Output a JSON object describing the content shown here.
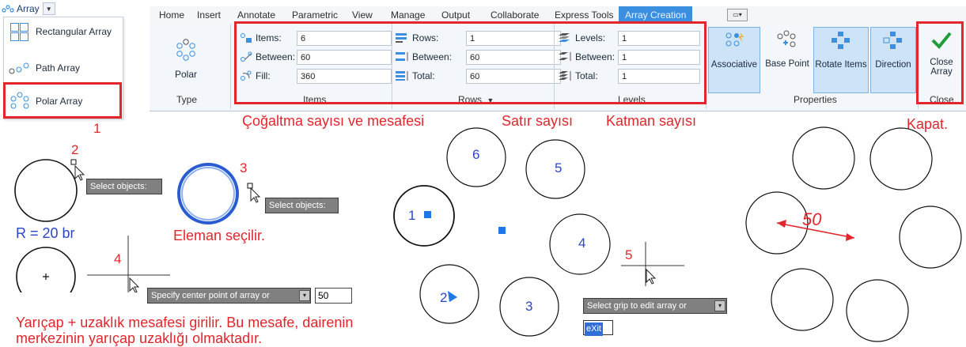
{
  "dropdown": {
    "title": "Array",
    "items": [
      {
        "label": "Rectangular Array",
        "icon": "rectangular-array-icon"
      },
      {
        "label": "Path Array",
        "icon": "path-array-icon"
      },
      {
        "label": "Polar Array",
        "icon": "polar-array-icon"
      }
    ]
  },
  "ribbon": {
    "tabs": [
      "Home",
      "Insert",
      "Annotate",
      "Parametric",
      "View",
      "Manage",
      "Output",
      "Collaborate",
      "Express Tools",
      "Array Creation"
    ],
    "active_tab": "Array Creation",
    "type_panel": {
      "button_label": "Polar",
      "title": "Type"
    },
    "items_panel": {
      "title": "Items",
      "fields": [
        {
          "label": "Items:",
          "value": "6"
        },
        {
          "label": "Between:",
          "value": "60"
        },
        {
          "label": "Fill:",
          "value": "360"
        }
      ]
    },
    "rows_panel": {
      "title": "Rows",
      "fields": [
        {
          "label": "Rows:",
          "value": "1"
        },
        {
          "label": "Between:",
          "value": "60"
        },
        {
          "label": "Total:",
          "value": "60"
        }
      ]
    },
    "levels_panel": {
      "title": "Levels",
      "fields": [
        {
          "label": "Levels:",
          "value": "1"
        },
        {
          "label": "Between:",
          "value": "1"
        },
        {
          "label": "Total:",
          "value": "1"
        }
      ]
    },
    "properties_panel": {
      "title": "Properties",
      "buttons": [
        "Associative",
        "Base Point",
        "Rotate Items",
        "Direction"
      ]
    },
    "close_panel": {
      "title": "Close",
      "button_line1": "Close",
      "button_line2": "Array"
    }
  },
  "annotations": {
    "num1": "1",
    "items_note": "Çoğaltma sayısı ve mesafesi",
    "rows_note": "Satır sayısı",
    "levels_note": "Katman sayısı",
    "close_note": "Kapat.",
    "num2": "2",
    "num3": "3",
    "num4": "4",
    "num5": "5",
    "radius_note": "R = 20 br",
    "select_note": "Eleman seçilir.",
    "bottom_line1": "Yarıçap + uzaklık mesafesi girilir. Bu mesafe, dairenin",
    "bottom_line2": "merkezinin yarıçap uzaklığı olmaktadır.",
    "distance_label": "50"
  },
  "prompts": {
    "select_objects_1": "Select objects:",
    "select_objects_2": "Select objects:",
    "center_point": "Specify center point of array or",
    "center_value": "50",
    "grip_prompt": "Select grip to edit array or",
    "exit_option": "eXit"
  },
  "circle_numbers": [
    "1",
    "2",
    "3",
    "4",
    "5",
    "6"
  ],
  "colors": {
    "accent": "#3b8fe0",
    "annotation_red": "#e1262c",
    "number_blue": "#2b46c4",
    "grip_blue": "#1e78e6",
    "check_green": "#1f9d3a"
  }
}
